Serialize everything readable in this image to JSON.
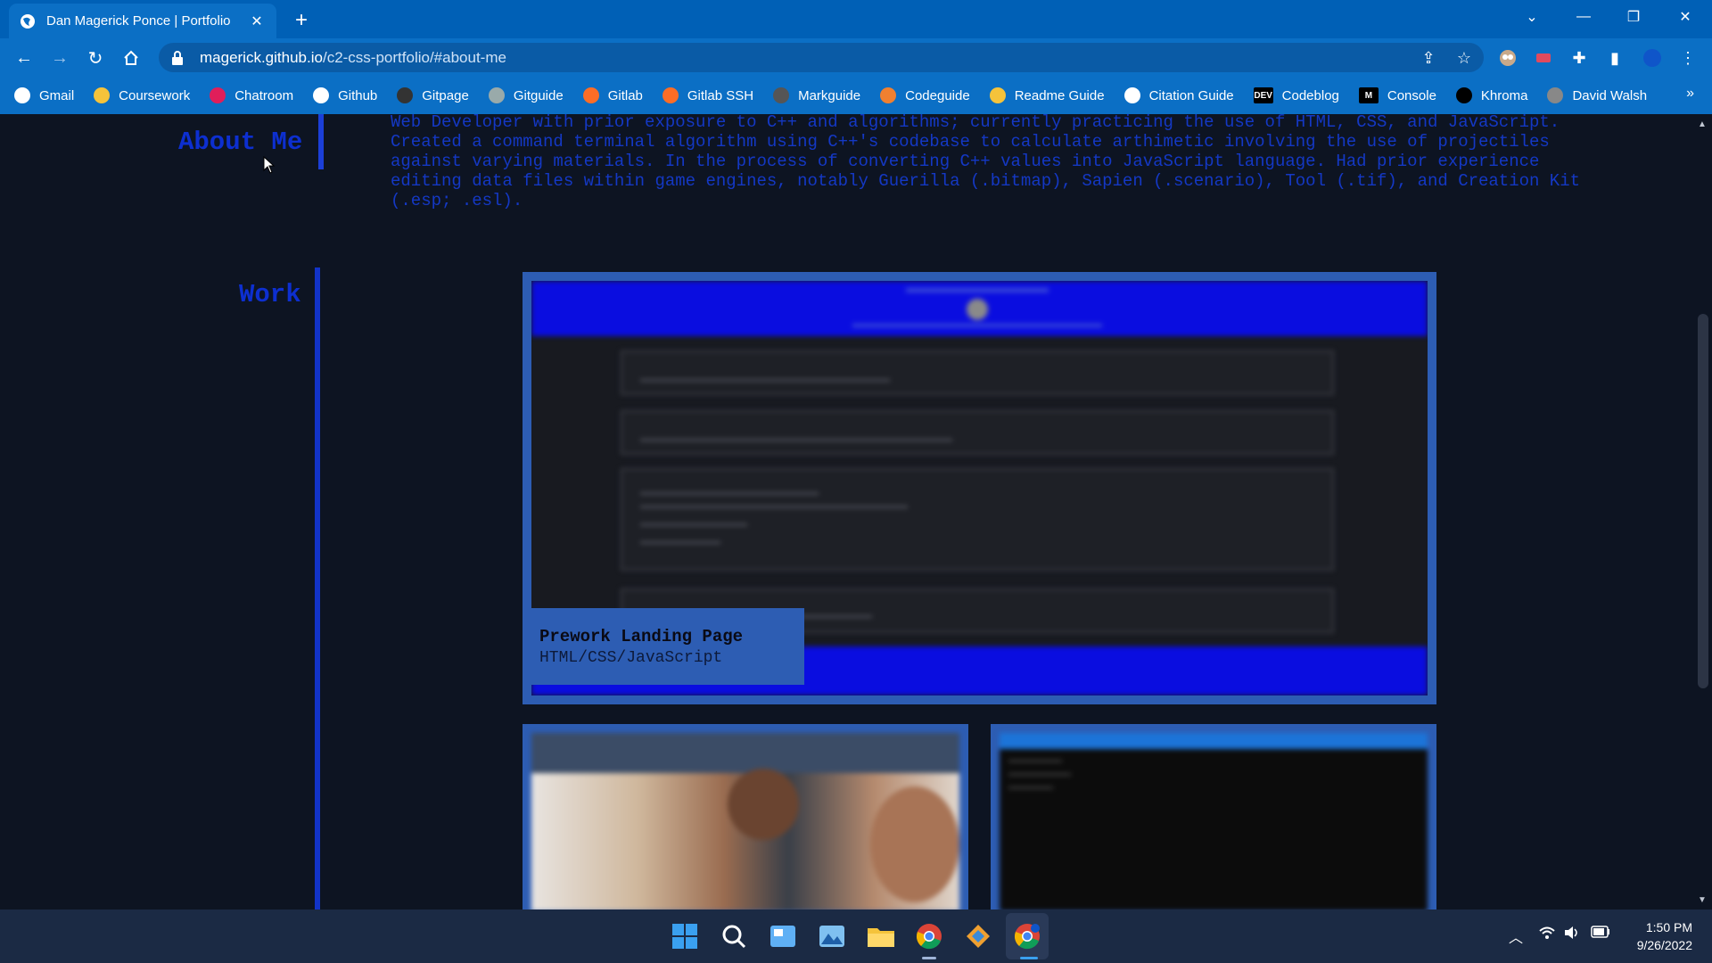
{
  "browser": {
    "tab": {
      "title": "Dan Magerick Ponce | Portfolio"
    },
    "address": {
      "host": "magerick.github.io",
      "path": "/c2-css-portfolio/#about-me"
    },
    "bookmarks": [
      {
        "label": "Gmail",
        "icon": "gmail-icon"
      },
      {
        "label": "Coursework",
        "icon": "coursework-icon"
      },
      {
        "label": "Chatroom",
        "icon": "slack-icon"
      },
      {
        "label": "Github",
        "icon": "github-icon"
      },
      {
        "label": "Gitpage",
        "icon": "gitpage-icon"
      },
      {
        "label": "Gitguide",
        "icon": "globe-icon"
      },
      {
        "label": "Gitlab",
        "icon": "gitlab-icon"
      },
      {
        "label": "Gitlab SSH",
        "icon": "gitlab-icon"
      },
      {
        "label": "Markguide",
        "icon": "markdown-icon"
      },
      {
        "label": "Codeguide",
        "icon": "codeguide-icon"
      },
      {
        "label": "Readme Guide",
        "icon": "readme-icon"
      },
      {
        "label": "Citation Guide",
        "icon": "google-icon"
      },
      {
        "label": "Codeblog",
        "icon": "dev-icon",
        "badge": "DEV"
      },
      {
        "label": "Console",
        "icon": "console-icon",
        "badge": "M"
      },
      {
        "label": "Khroma",
        "icon": "khroma-icon"
      },
      {
        "label": "David Walsh",
        "icon": "davidwalsh-icon"
      }
    ],
    "bookmarks_more": "»"
  },
  "page": {
    "about_heading": "About Me",
    "about_text": "Web Developer with prior exposure to C++ and algorithms; currently practicing the use of HTML, CSS, and JavaScript. Created a command terminal algorithm using C++'s codebase to calculate arthimetic involving the use of projectiles against varying materials. In the process of converting C++ values into JavaScript language. Had prior experience editing data files within game engines, notably Guerilla (.bitmap), Sapien (.scenario), Tool (.tif), and Creation Kit (.esp; .esl).",
    "work_heading": "Work",
    "featured_project": {
      "title": "Prework Landing Page",
      "tech": "HTML/CSS/JavaScript"
    }
  },
  "taskbar": {
    "time": "1:50 PM",
    "date": "9/26/2022"
  },
  "colors": {
    "accent": "#0d2fd0",
    "frame": "#2d5db3",
    "background": "#0d1422",
    "chrome": "#0b6fc5"
  }
}
